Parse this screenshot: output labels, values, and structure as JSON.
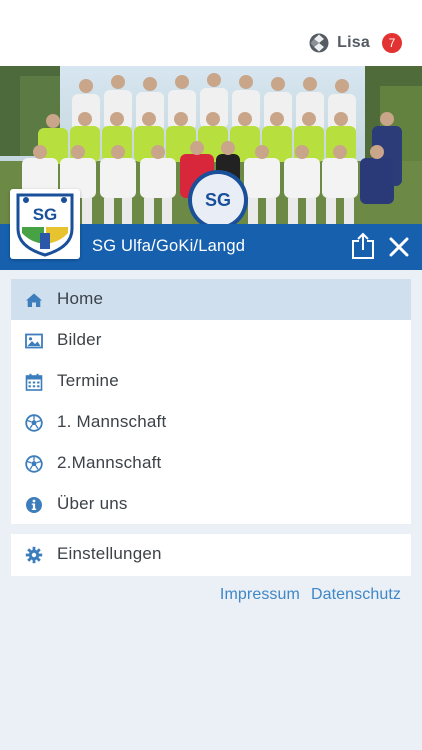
{
  "user": {
    "name": "Lisa",
    "notification_count": "7",
    "icon": "club-logo-icon"
  },
  "club": {
    "name": "SG Ulfa/GoKi/Langd",
    "logo_text": "SG"
  },
  "colors": {
    "brand_blue": "#1660ae",
    "active_row": "#cfdfee",
    "icon_blue": "#3c7dbb",
    "link_blue": "#3f87c6",
    "badge_red": "#e23232",
    "background": "#ebf0f7"
  },
  "menu": {
    "items": [
      {
        "label": "Home",
        "icon": "home-icon",
        "active": true
      },
      {
        "label": "Bilder",
        "icon": "image-icon"
      },
      {
        "label": "Termine",
        "icon": "calendar-icon"
      },
      {
        "label": "1. Mannschaft",
        "icon": "soccer-ball-icon"
      },
      {
        "label": "2.Mannschaft",
        "icon": "soccer-ball-icon"
      },
      {
        "label": "Über uns",
        "icon": "info-icon"
      }
    ],
    "settings": {
      "label": "Einstellungen",
      "icon": "gear-icon"
    }
  },
  "footer": {
    "impressum": "Impressum",
    "datenschutz": "Datenschutz"
  }
}
